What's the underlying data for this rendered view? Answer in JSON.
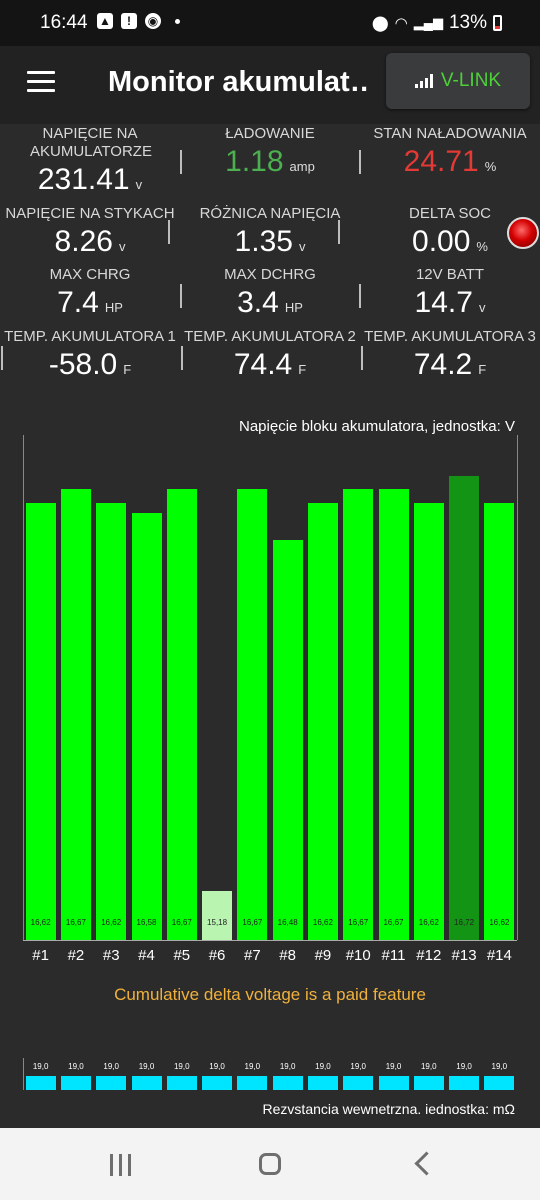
{
  "status_bar": {
    "time": "16:44",
    "battery": "13%"
  },
  "app_bar": {
    "title": "Monitor akumulat…",
    "vlink_label": "V-LINK"
  },
  "metrics": [
    {
      "label": "NAPIĘCIE NA AKUMULATORZE",
      "value": "231.41",
      "unit": "v",
      "color": "#ffffff"
    },
    {
      "label": "ŁADOWANIE",
      "value": "1.18",
      "unit": "amp",
      "color": "#4caf50"
    },
    {
      "label": "STAN NAŁADOWANIA",
      "value": "24.71",
      "unit": "%",
      "color": "#e53935"
    },
    {
      "label": "NAPIĘCIE NA STYKACH",
      "value": "8.26",
      "unit": "v",
      "color": "#ffffff"
    },
    {
      "label": "RÓŻNICA NAPIĘCIA",
      "value": "1.35",
      "unit": "v",
      "color": "#ffffff"
    },
    {
      "label": "DELTA SOC",
      "value": "0.00",
      "unit": "%",
      "color": "#ffffff"
    },
    {
      "label": "MAX CHRG",
      "value": "7.4",
      "unit": "HP",
      "color": "#ffffff"
    },
    {
      "label": "MAX DCHRG",
      "value": "3.4",
      "unit": "HP",
      "color": "#ffffff"
    },
    {
      "label": "12V BATT",
      "value": "14.7",
      "unit": "v",
      "color": "#ffffff"
    },
    {
      "label": "TEMP. AKUMULATORA 1",
      "value": "-58.0",
      "unit": "F",
      "color": "#ffffff"
    },
    {
      "label": "TEMP. AKUMULATORA 2",
      "value": "74.4",
      "unit": "F",
      "color": "#ffffff"
    },
    {
      "label": "TEMP. AKUMULATORA 3",
      "value": "74.2",
      "unit": "F",
      "color": "#ffffff"
    }
  ],
  "chart_data": {
    "type": "bar",
    "title": "Napięcie bloku akumulatora, jednostka: V",
    "categories": [
      "#1",
      "#2",
      "#3",
      "#4",
      "#5",
      "#6",
      "#7",
      "#8",
      "#9",
      "#10",
      "#11",
      "#12",
      "#13",
      "#14"
    ],
    "values": [
      16.62,
      16.67,
      16.62,
      16.58,
      16.67,
      15.18,
      16.67,
      16.48,
      16.62,
      16.67,
      16.67,
      16.62,
      16.72,
      16.62
    ],
    "value_labels": [
      "16,62",
      "16,67",
      "16,62",
      "16,58",
      "16,67",
      "15,18",
      "16,67",
      "16,48",
      "16,62",
      "16,67",
      "16,67",
      "16,62",
      "16,72",
      "16,62"
    ],
    "ylim": [
      15.0,
      16.87
    ],
    "colors": {
      "normal": "#00ff00",
      "min": "#b9f5b0",
      "max": "#149414"
    },
    "min_index": 5,
    "max_index": 12
  },
  "paid_note": "Cumulative delta voltage is a paid feature",
  "resistance": {
    "title": "Rezvstancia wewnetrzna. iednostka: mΩ",
    "values": [
      "19,0",
      "19,0",
      "19,0",
      "19,0",
      "19,0",
      "19,0",
      "19,0",
      "19,0",
      "19,0",
      "19,0",
      "19,0",
      "19,0",
      "19,0",
      "19,0"
    ],
    "color": "#00e5ff"
  }
}
